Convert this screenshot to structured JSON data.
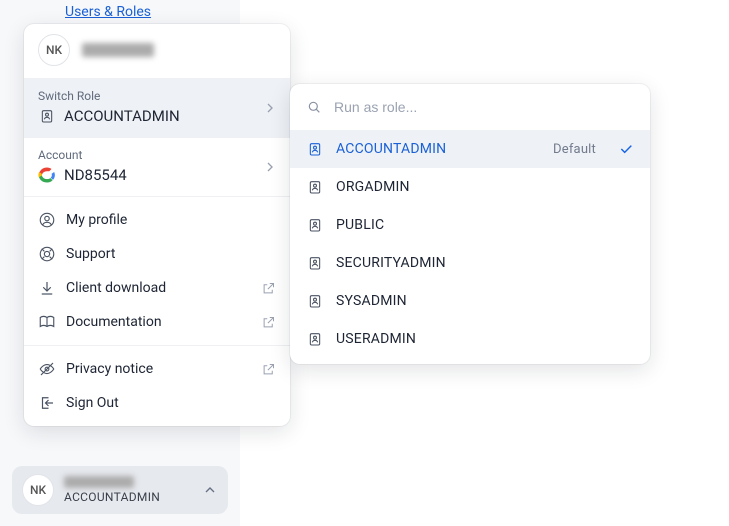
{
  "background": {
    "link_text": "Users & Roles"
  },
  "avatar_initials": "NK",
  "panel": {
    "switch_role": {
      "label": "Switch Role",
      "value": "ACCOUNTADMIN"
    },
    "account": {
      "label": "Account",
      "value": "ND85544"
    },
    "menu": {
      "my_profile": "My profile",
      "support": "Support",
      "client_download": "Client download",
      "documentation": "Documentation",
      "privacy_notice": "Privacy notice",
      "sign_out": "Sign Out"
    }
  },
  "role_panel": {
    "search_placeholder": "Run as role...",
    "default_tag": "Default",
    "roles": [
      {
        "name": "ACCOUNTADMIN",
        "selected": true,
        "is_default": true
      },
      {
        "name": "ORGADMIN",
        "selected": false,
        "is_default": false
      },
      {
        "name": "PUBLIC",
        "selected": false,
        "is_default": false
      },
      {
        "name": "SECURITYADMIN",
        "selected": false,
        "is_default": false
      },
      {
        "name": "SYSADMIN",
        "selected": false,
        "is_default": false
      },
      {
        "name": "USERADMIN",
        "selected": false,
        "is_default": false
      }
    ]
  },
  "footer_chip": {
    "role": "ACCOUNTADMIN"
  }
}
